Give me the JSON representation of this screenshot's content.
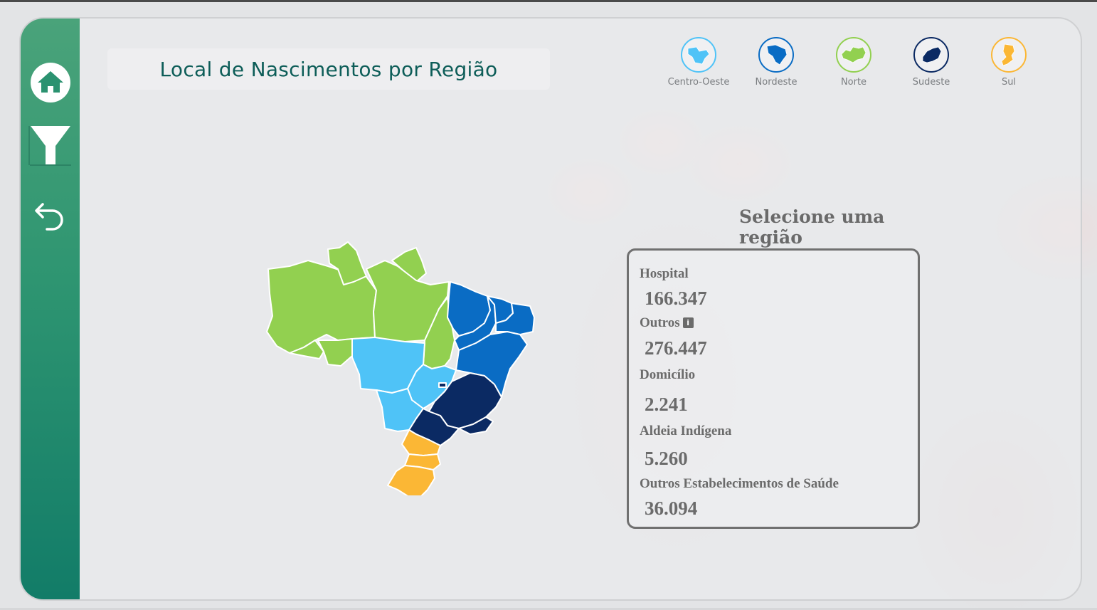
{
  "header": {
    "title": "Local de Nascimentos por Região"
  },
  "sidebar": {
    "buttons": [
      {
        "name": "home",
        "icon": "home-icon"
      },
      {
        "name": "filter",
        "icon": "funnel-icon"
      },
      {
        "name": "back",
        "icon": "undo-arrow-icon"
      }
    ]
  },
  "legend": {
    "items": [
      {
        "label": "Centro-Oeste",
        "color": "#4fc3f7"
      },
      {
        "label": "Nordeste",
        "color": "#0a6cc4"
      },
      {
        "label": "Norte",
        "color": "#92d050"
      },
      {
        "label": "Sudeste",
        "color": "#0b2a63"
      },
      {
        "label": "Sul",
        "color": "#fbb735"
      }
    ]
  },
  "prompt": {
    "text": "Selecione uma região"
  },
  "stats": {
    "items": [
      {
        "label": "Hospital",
        "value": "166.347"
      },
      {
        "label": "Outros",
        "value": "276.447"
      },
      {
        "label": "Domicílio",
        "value": "2.241"
      },
      {
        "label": "Aldeia Indígena",
        "value": "5.260"
      },
      {
        "label": "Outros Estabelecimentos de Saúde",
        "value": "36.094"
      }
    ],
    "info_icon": "info-icon"
  }
}
